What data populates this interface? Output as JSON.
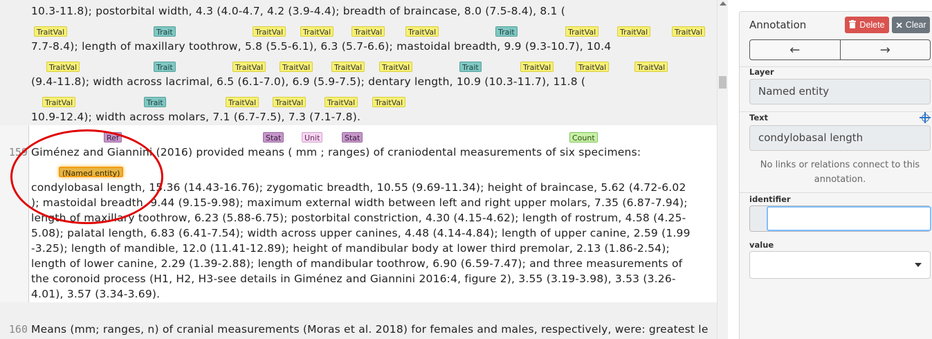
{
  "editor": {
    "lines": [
      "10.3-11.8); postorbital width,    4.3   (4.0-4.7,  4.2  (3.9-4.4); breadth of braincase,   8.0   (7.5-8.4),    8.1   (",
      "7.7-8.4); length of maxillary toothrow,   5.8    (5.5-6.1),   6.3     (5.7-6.6); mastoidal breadth,   9.9   (9.3-10.7),  10.4",
      "(9.4-11.8);  width across lacrimal,   6.5    (6.1-7.0),   6.9    (5.9-7.5); dentary length,  10.9   (10.3-11.7),   11.8   (",
      "10.9-12.4); width across molars,    7.1    (6.7-7.5),   7.3    (7.1-7.8).",
      "Giménez and Giannini (2016)  provided means ( mm ; ranges) of craniodental measurements   of   six    specimens:",
      "condylobasal length, 15.36 (14.43-16.76);   zygomatic breadth, 10.55 (9.69-11.34); height of braincase,   5.62 (4.72-6.02",
      "); mastoidal breadth, 9.44 (9.15-9.98); maximum   external width between left and right upper molars, 7.35   (6.87-7.94);",
      " length of maxillary toothrow, 6.23 (5.88-6.75);   postorbital constriction, 4.30 (4.15-4.62); length of rostrum,   4.58 (4.25-",
      "5.08); palatal length, 6.83 (6.41-7.54); width across   upper canines, 4.48 (4.14-4.84); length of upper canine, 2.59   (1.99",
      "-3.25); length of mandible, 12.0 (11.41-12.89); height   of mandibular body at lower third premolar, 2.13 (1.86-2.54);",
      "  length of lower canine, 2.29 (1.39-2.88); length of mandibular   toothrow, 6.90 (6.59-7.47); and three measurements of",
      " the coronoid   process (H1, H2, H3-see details in Giménez and Giannini   2016:4, figure 2), 3.55 (3.19-3.98), 3.53 (3.26-",
      "4.01), 3.57   (3.34-3.69).",
      "Means (mm; ranges, n) of cranial measurements (Moras et al. 2018) for females and males, respectively, were: greatest le"
    ],
    "line_numbers": {
      "s159": "159",
      "s160": "160"
    },
    "chips": {
      "traitval": "TraitVal",
      "trait": "Trait",
      "ref": "Ref",
      "stat": "Stat",
      "unit": "Unit",
      "count": "Count",
      "named_entity": "(Named entity)"
    }
  },
  "panel": {
    "title": "Annotation",
    "delete_label": "Delete",
    "clear_label": "Clear",
    "prev_arrow": "←",
    "next_arrow": "→",
    "layer_label": "Layer",
    "layer_value": "Named entity",
    "text_label": "Text",
    "text_value": "condylobasal length",
    "no_links_note": "No links or relations connect to this annotation.",
    "identifier_label": "identifier",
    "identifier_value": "",
    "value_label": "value",
    "value_selected": ""
  },
  "colors": {
    "traitval": "#f7f075",
    "trait": "#7fc7c2",
    "stat": "#c596c9",
    "unit": "#f7d6f2",
    "count": "#c8f0a8",
    "named_entity": "#e9b544",
    "delete": "#d9534f",
    "highlight_circle": "#e00000"
  }
}
